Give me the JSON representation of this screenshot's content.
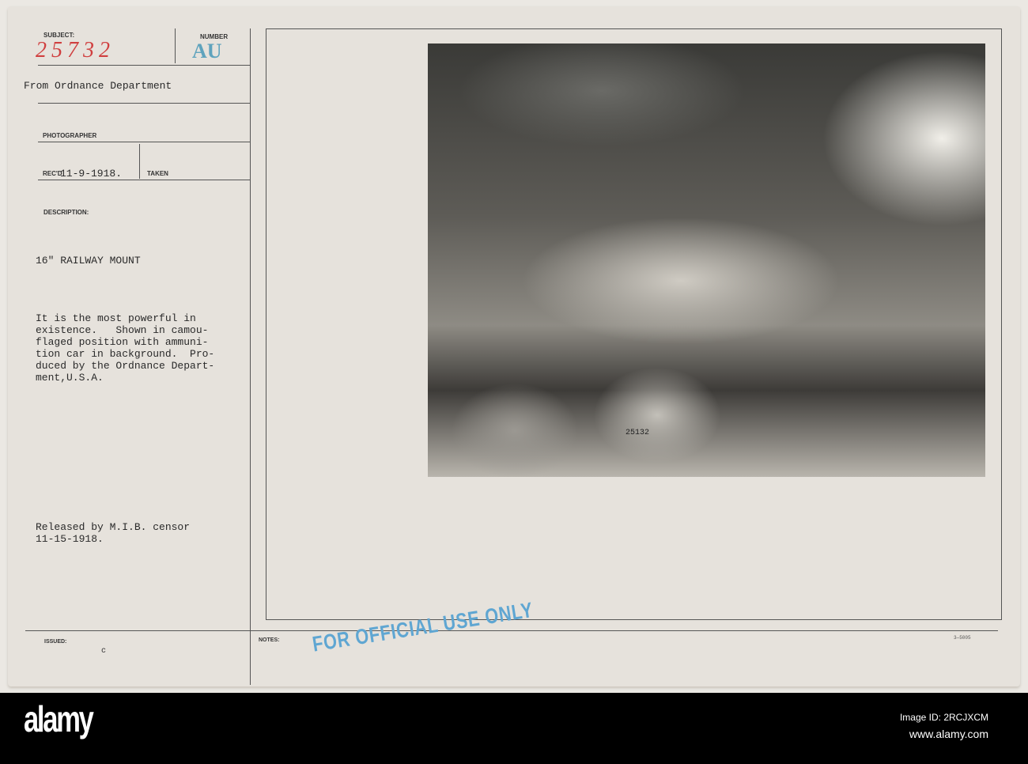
{
  "card": {
    "subject_label": "SUBJECT:",
    "subject_value": "25732",
    "number_label": "NUMBER",
    "number_value": "AU",
    "from": "From Ordnance Department",
    "photographer_label": "PHOTOGRAPHER",
    "recd_label": "REC'D",
    "recd_value": "11-9-1918.",
    "taken_label": "TAKEN",
    "description_label": "DESCRIPTION:",
    "title": "16\" RAILWAY MOUNT",
    "description": [
      "It is the most powerful in",
      "existence.   Shown in camou-",
      "flaged position with ammuni-",
      "tion car in background.  Pro-",
      "duced by the Ordnance Depart-",
      "ment,U.S.A."
    ],
    "released": [
      "Released by M.I.B. censor",
      "11-15-1918."
    ],
    "issued_label": "ISSUED:",
    "issued_mark": "c",
    "notes_label": "NOTES:",
    "stamp": "FOR OFFICIAL USE ONLY",
    "form_number": "3—5005",
    "photo_number": "25132"
  },
  "footer": {
    "logo": "alamy",
    "image_id": "Image ID: 2RCJXCM",
    "url": "www.alamy.com"
  }
}
